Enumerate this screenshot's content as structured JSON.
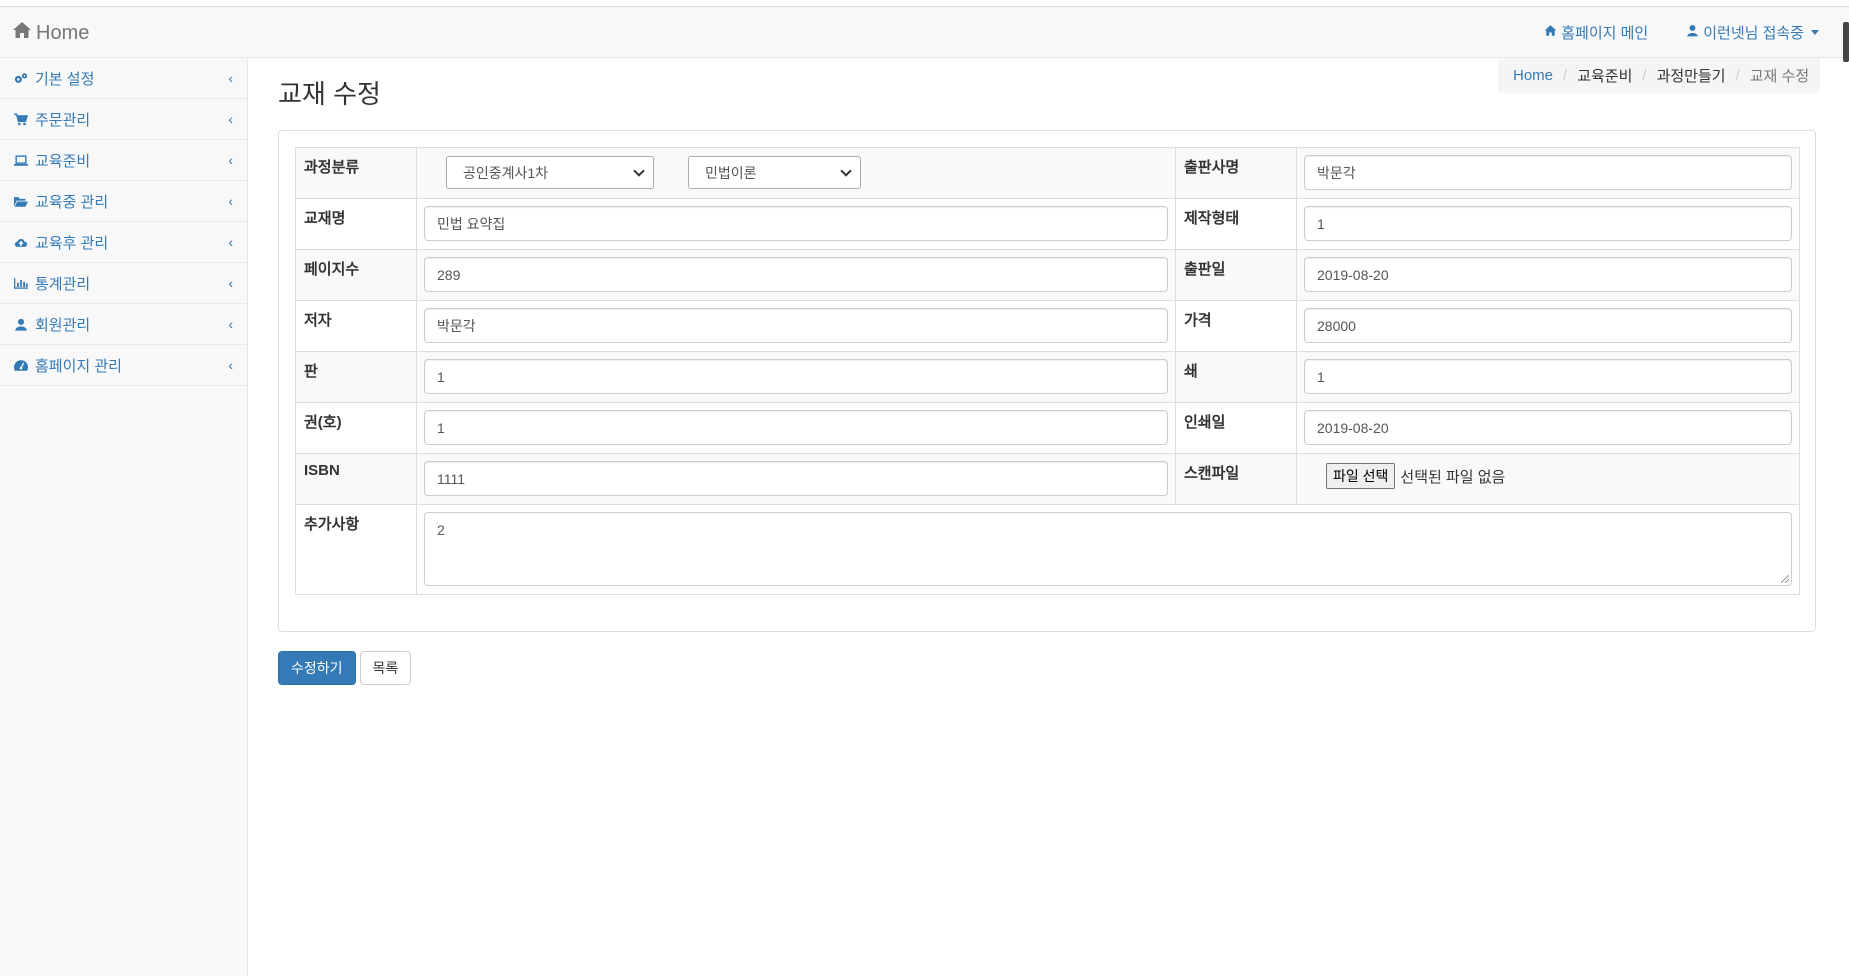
{
  "navbar": {
    "brand": "Home",
    "homepage_link": "홈페이지 메인",
    "user_menu": "이런넷님 접속중"
  },
  "sidebar": {
    "items": [
      {
        "label": "기본 설정",
        "icon": "gears-icon"
      },
      {
        "label": "주문관리",
        "icon": "cart-icon"
      },
      {
        "label": "교육준비",
        "icon": "laptop-icon"
      },
      {
        "label": "교육중 관리",
        "icon": "folder-open-icon"
      },
      {
        "label": "교육후 관리",
        "icon": "cloud-upload-icon"
      },
      {
        "label": "통계관리",
        "icon": "bar-chart-icon"
      },
      {
        "label": "회원관리",
        "icon": "user-icon"
      },
      {
        "label": "홈페이지 관리",
        "icon": "dashboard-icon"
      }
    ],
    "chevron": "‹"
  },
  "page": {
    "title": "교재 수정",
    "breadcrumb": [
      "Home",
      "교육준비",
      "과정만들기",
      "교재 수정"
    ]
  },
  "form": {
    "category_label": "과정분류",
    "category_select1": "공인중계사1차",
    "category_select2": "민법이론",
    "publisher_label": "출판사명",
    "publisher_value": "박문각",
    "title_label": "교재명",
    "title_value": "민법 요약집",
    "format_label": "제작형태",
    "format_value": "1",
    "pages_label": "페이지수",
    "pages_value": "289",
    "pubdate_label": "출판일",
    "pubdate_value": "2019-08-20",
    "author_label": "저자",
    "author_value": "박문각",
    "price_label": "가격",
    "price_value": "28000",
    "edition_label": "판",
    "edition_value": "1",
    "printing_label": "쇄",
    "printing_value": "1",
    "volume_label": "권(호)",
    "volume_value": "1",
    "printdate_label": "인쇄일",
    "printdate_value": "2019-08-20",
    "isbn_label": "ISBN",
    "isbn_value": "1111",
    "scanfile_label": "스캔파일",
    "file_button": "파일 선택",
    "file_status": "선택된 파일 없음",
    "notes_label": "추가사항",
    "notes_value": "2"
  },
  "buttons": {
    "submit": "수정하기",
    "list": "목록"
  },
  "colors": {
    "link": "#337ab7",
    "primary": "#337ab7"
  }
}
